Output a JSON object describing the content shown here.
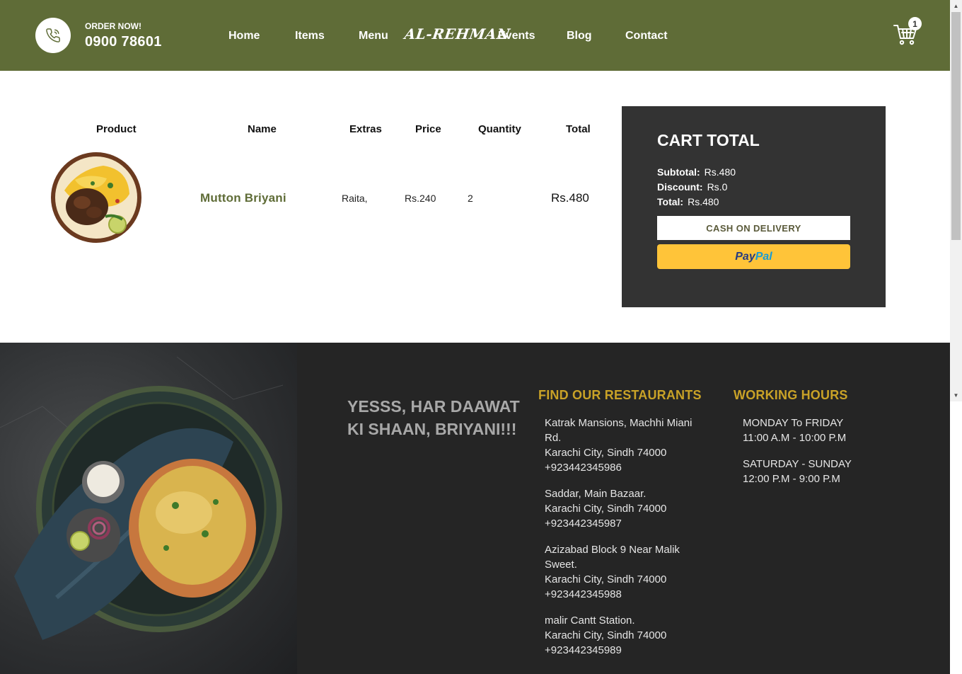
{
  "header": {
    "order_label": "ORDER NOW!",
    "phone": "0900 78601",
    "nav": [
      "Home",
      "Items",
      "Menu",
      "Events",
      "Blog",
      "Contact"
    ],
    "logo": "AL-REHMAN",
    "cart_count": "1"
  },
  "table": {
    "headers": [
      "Product",
      "Name",
      "Extras",
      "Price",
      "Quantity",
      "Total"
    ],
    "item": {
      "name": "Mutton Briyani",
      "extras": "Raita,",
      "price": "Rs.240",
      "quantity": "2",
      "total": "Rs.480"
    }
  },
  "cart_total": {
    "title": "CART TOTAL",
    "subtotal_label": "Subtotal:",
    "subtotal": "Rs.480",
    "discount_label": "Discount:",
    "discount": "Rs.0",
    "total_label": "Total:",
    "total": "Rs.480",
    "cod_label": "CASH ON DELIVERY",
    "paypal_a": "Pay",
    "paypal_b": "Pal"
  },
  "footer": {
    "tagline": "YESSS, HAR DAAWAT KI SHAAN, BRIYANI!!!",
    "restaurants_title": "FIND OUR RESTAURANTS",
    "restaurants": [
      {
        "line1": "Katrak Mansions, Machhi Miani Rd.",
        "line2": "Karachi City, Sindh 74000",
        "phone": "+923442345986"
      },
      {
        "line1": "Saddar, Main Bazaar.",
        "line2": "Karachi City, Sindh 74000",
        "phone": "+923442345987"
      },
      {
        "line1": "Azizabad Block 9 Near Malik Sweet.",
        "line2": "Karachi City, Sindh 74000",
        "phone": "+923442345988"
      },
      {
        "line1": "malir Cantt Station.",
        "line2": "Karachi City, Sindh 74000",
        "phone": "+923442345989"
      }
    ],
    "hours_title": "WORKING HOURS",
    "hours": [
      {
        "days": "MONDAY To FRIDAY",
        "time": "11:00 A.M - 10:00 P.M"
      },
      {
        "days": "SATURDAY - SUNDAY",
        "time": "12:00 P.M - 9:00 P.M"
      }
    ]
  },
  "colors": {
    "header_bg": "#5f6c37",
    "accent_gold": "#c9a227",
    "cart_box_bg": "#333333",
    "footer_bg": "#252525",
    "paypal_yellow": "#ffc439"
  },
  "icons": [
    "phone-icon",
    "cart-icon"
  ]
}
